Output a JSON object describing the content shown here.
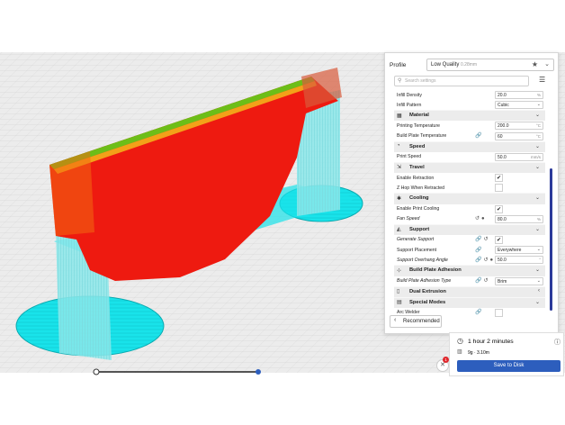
{
  "profile": {
    "label": "Profile",
    "quality": "Low Quality",
    "quality_sub": "0.28mm",
    "star_icon": "star-icon",
    "chevron_icon": "chevron-down-icon"
  },
  "search": {
    "placeholder": "Search settings",
    "icon": "search-icon"
  },
  "settings_menu_icon": "menu-icon",
  "rows": [
    {
      "type": "setting",
      "label": "Infill Density",
      "value": "20.0",
      "unit": "%"
    },
    {
      "type": "setting",
      "label": "Infill Pattern",
      "value": "Cubic",
      "dropdown": true
    },
    {
      "type": "category",
      "label": "Material",
      "icon": "material-icon",
      "open": true
    },
    {
      "type": "setting",
      "label": "Printing Temperature",
      "value": "200.0",
      "unit": "°C"
    },
    {
      "type": "setting",
      "label": "Build Plate Temperature",
      "value": "60",
      "unit": "°C",
      "icons": "link"
    },
    {
      "type": "category",
      "label": "Speed",
      "icon": "speed-icon",
      "open": true
    },
    {
      "type": "setting",
      "label": "Print Speed",
      "value": "50.0",
      "unit": "mm/s"
    },
    {
      "type": "category",
      "label": "Travel",
      "icon": "travel-icon",
      "open": true
    },
    {
      "type": "checkbox",
      "label": "Enable Retraction",
      "checked": true
    },
    {
      "type": "checkbox",
      "label": "Z Hop When Retracted",
      "checked": false
    },
    {
      "type": "category",
      "label": "Cooling",
      "icon": "cooling-icon",
      "open": true
    },
    {
      "type": "checkbox",
      "label": "Enable Print Cooling",
      "checked": true
    },
    {
      "type": "setting",
      "label": "Fan Speed",
      "value": "80.0",
      "unit": "%",
      "italic": true,
      "icons": "reset-info"
    },
    {
      "type": "category",
      "label": "Support",
      "icon": "support-icon",
      "open": true
    },
    {
      "type": "checkbox",
      "label": "Generate Support",
      "checked": true,
      "italic": true,
      "icons": "link-reset"
    },
    {
      "type": "setting",
      "label": "Support Placement",
      "value": "Everywhere",
      "dropdown": true,
      "icons": "link"
    },
    {
      "type": "setting",
      "label": "Support Overhang Angle",
      "value": "50.0",
      "unit": "°",
      "italic": true,
      "icons": "link-reset-info"
    },
    {
      "type": "category",
      "label": "Build Plate Adhesion",
      "icon": "adhesion-icon",
      "open": true
    },
    {
      "type": "setting",
      "label": "Build Plate Adhesion Type",
      "value": "Brim",
      "dropdown": true,
      "italic": true,
      "icons": "link-reset"
    },
    {
      "type": "category",
      "label": "Dual Extrusion",
      "icon": "dual-extrusion-icon",
      "open": false
    },
    {
      "type": "category",
      "label": "Special Modes",
      "icon": "special-modes-icon",
      "open": true
    },
    {
      "type": "checkbox",
      "label": "Arc Welder",
      "checked": false,
      "icons": "link"
    }
  ],
  "recommended_label": "Recommended",
  "print_info": {
    "time": "1 hour 2 minutes",
    "material": "9g · 3.10m",
    "save_label": "Save to Disk"
  },
  "notification_count": "1",
  "colors": {
    "model": "#ee1a10",
    "support": "#19e3ea",
    "accent": "#2d5ebd",
    "grid": "#c9c9c9",
    "build_plate": "#ececec"
  }
}
